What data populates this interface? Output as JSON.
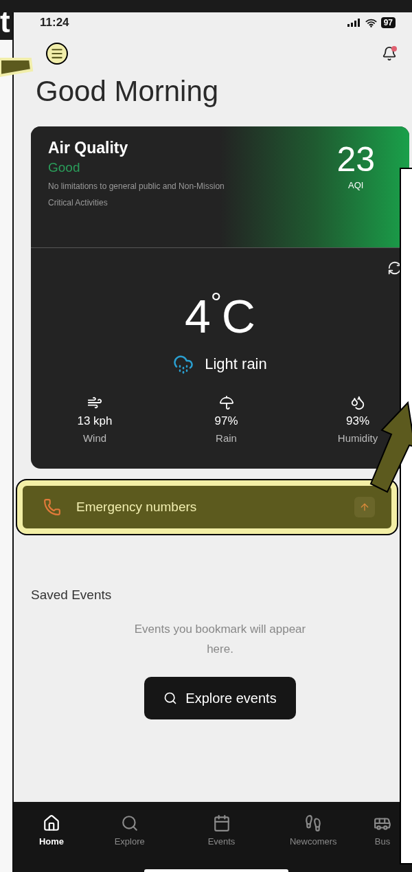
{
  "annotation": {
    "label": "t"
  },
  "status_bar": {
    "time": "11:24",
    "battery": "97"
  },
  "header": {
    "title": "Good Morning",
    "notification_badge": true,
    "menu_highlighted": true
  },
  "air_quality": {
    "title": "Air Quality",
    "status": "Good",
    "description": "No limitations to general public and Non-Mission Critical Activities",
    "aqi": "23",
    "aqi_label": "AQI"
  },
  "weather": {
    "temperature": "4$^{°}$C",
    "condition": "Light rain",
    "stats": [
      {
        "kind": "wind",
        "value": "13 kph",
        "label": "Wind"
      },
      {
        "kind": "rain",
        "value": "97%",
        "label": "Rain"
      },
      {
        "kind": "humidity",
        "value": "93%",
        "label": "Humidity"
      }
    ]
  },
  "emergency": {
    "label": "Emergency numbers",
    "highlighted": true
  },
  "saved_events": {
    "title": "Saved Events",
    "empty_message": "Events you bookmark will appear here.",
    "button": "Explore events"
  },
  "nav": [
    {
      "kind": "home",
      "label": "Home",
      "selected": true
    },
    {
      "kind": "explore",
      "label": "Explore",
      "selected": false
    },
    {
      "kind": "events",
      "label": "Events",
      "selected": false
    },
    {
      "kind": "newcomers",
      "label": "Newcomers",
      "selected": false
    },
    {
      "kind": "bus",
      "label": "Bus",
      "selected": false
    }
  ]
}
